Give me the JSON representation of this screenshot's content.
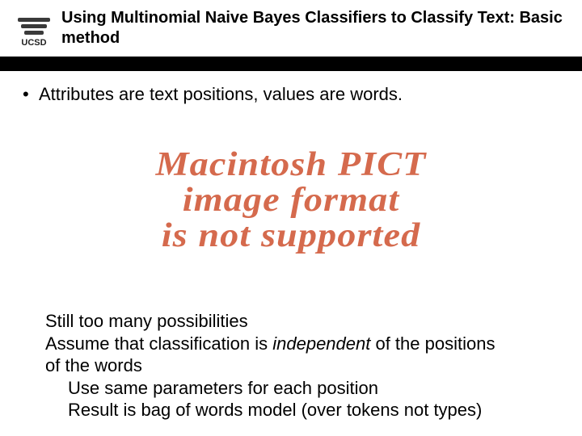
{
  "header": {
    "title_line1": "Using Multinomial Naive Bayes Classifiers to Classify Text: Basic",
    "title_line2": "method",
    "logo_alt": "UCSD"
  },
  "content": {
    "bullet1": "Attributes are text positions, values are words."
  },
  "pict": {
    "line1": "Macintosh PICT",
    "line2": "image format",
    "line3": "is not supported"
  },
  "body": {
    "l1": "Still too many possibilities",
    "l2a": "Assume that classification is ",
    "l2b_italic": "independent",
    "l2c": " of the positions",
    "l3": "of the words",
    "l4": "Use same parameters for each position",
    "l5": "Result is bag of words model (over tokens not types)"
  }
}
